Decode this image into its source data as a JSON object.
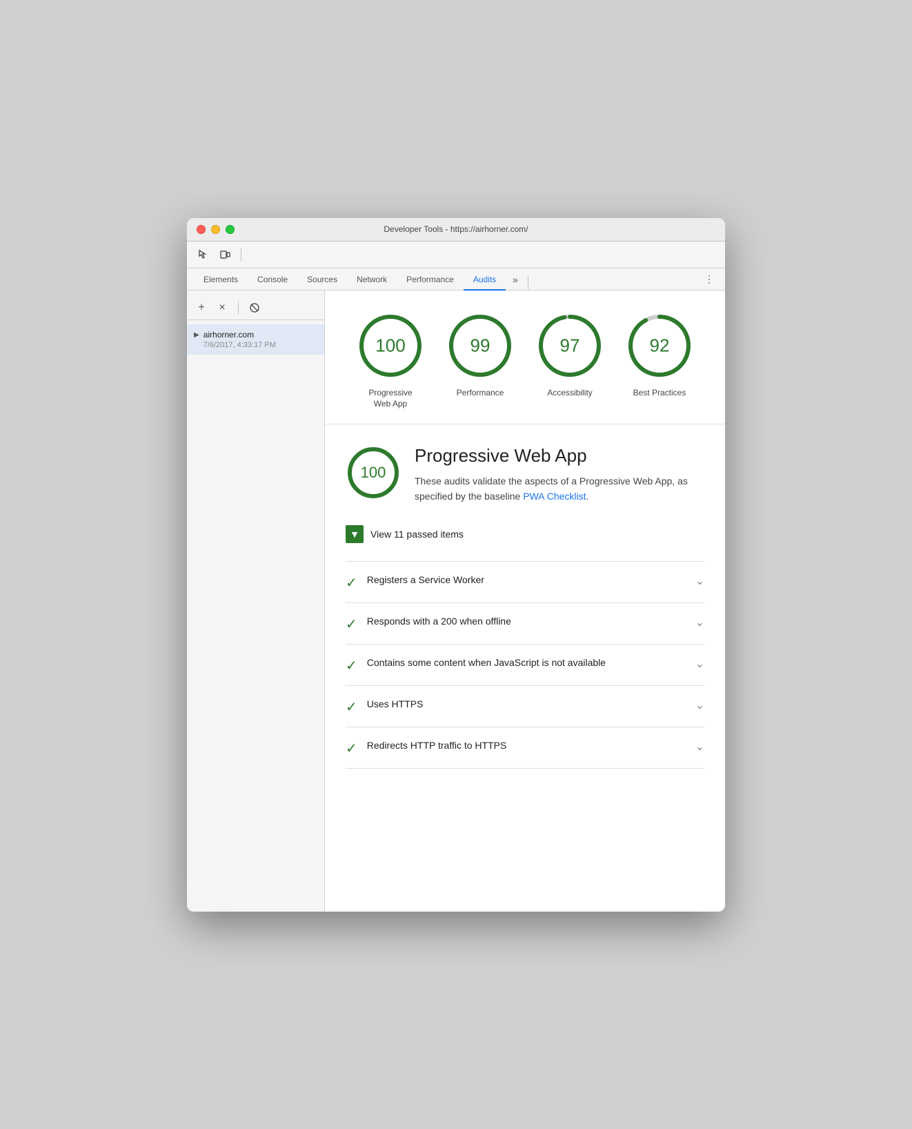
{
  "window": {
    "title": "Developer Tools - https://airhorner.com/"
  },
  "tabs": {
    "items": [
      {
        "label": "Elements",
        "active": false
      },
      {
        "label": "Console",
        "active": false
      },
      {
        "label": "Sources",
        "active": false
      },
      {
        "label": "Network",
        "active": false
      },
      {
        "label": "Performance",
        "active": false
      },
      {
        "label": "Audits",
        "active": true
      }
    ],
    "more_label": "»",
    "menu_label": "⋮"
  },
  "sidebar": {
    "add_label": "+",
    "close_label": "×",
    "block_label": "🚫",
    "item": {
      "title": "airhorner.com",
      "subtitle": "7/6/2017, 4:33:17 PM"
    }
  },
  "scores": [
    {
      "value": 100,
      "label": "Progressive Web App",
      "percent": 100
    },
    {
      "value": 99,
      "label": "Performance",
      "percent": 99
    },
    {
      "value": 97,
      "label": "Accessibility",
      "percent": 97
    },
    {
      "value": 92,
      "label": "Best Practices",
      "percent": 92
    }
  ],
  "pwa": {
    "score": 100,
    "title": "Progressive Web App",
    "description": "These audits validate the aspects of a Progressive Web App, as specified by the baseline ",
    "link_text": "PWA Checklist",
    "description_end": ".",
    "view_passed_label": "View 11 passed items"
  },
  "audit_items": [
    {
      "text": "Registers a Service Worker"
    },
    {
      "text": "Responds with a 200 when offline"
    },
    {
      "text": "Contains some content when JavaScript is not available"
    },
    {
      "text": "Uses HTTPS"
    },
    {
      "text": "Redirects HTTP traffic to HTTPS"
    }
  ]
}
